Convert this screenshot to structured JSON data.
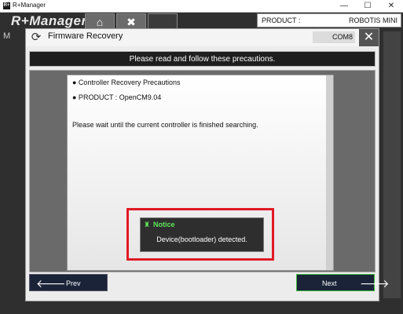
{
  "os_window": {
    "title": "R+Manager",
    "icon_text": "R+",
    "controls": {
      "minimize": "—",
      "maximize": "☐",
      "close": "✕"
    }
  },
  "app": {
    "logo": "R+Manager",
    "product_label": "PRODUCT :",
    "product_value": "ROBOTIS MINI",
    "side_letter": "M",
    "icons": [
      "home-icon",
      "tools-icon",
      "extra-icon"
    ]
  },
  "dialog": {
    "title": "Firmware Recovery",
    "port": "COM8",
    "banner": "Please read and follow these precautions.",
    "lines": [
      "● Controller Recovery Precautions",
      "● PRODUCT : OpenCM9.04"
    ],
    "status_message": "Please wait until the current controller is finished searching.",
    "notice": {
      "title": "Notice",
      "message": "Device(bootloader) detected."
    },
    "prev_label": "Prev",
    "next_label": "Next"
  },
  "colors": {
    "highlight": "#e01a25",
    "notice_accent": "#5ee85a",
    "next_border": "#3fbe3f"
  }
}
